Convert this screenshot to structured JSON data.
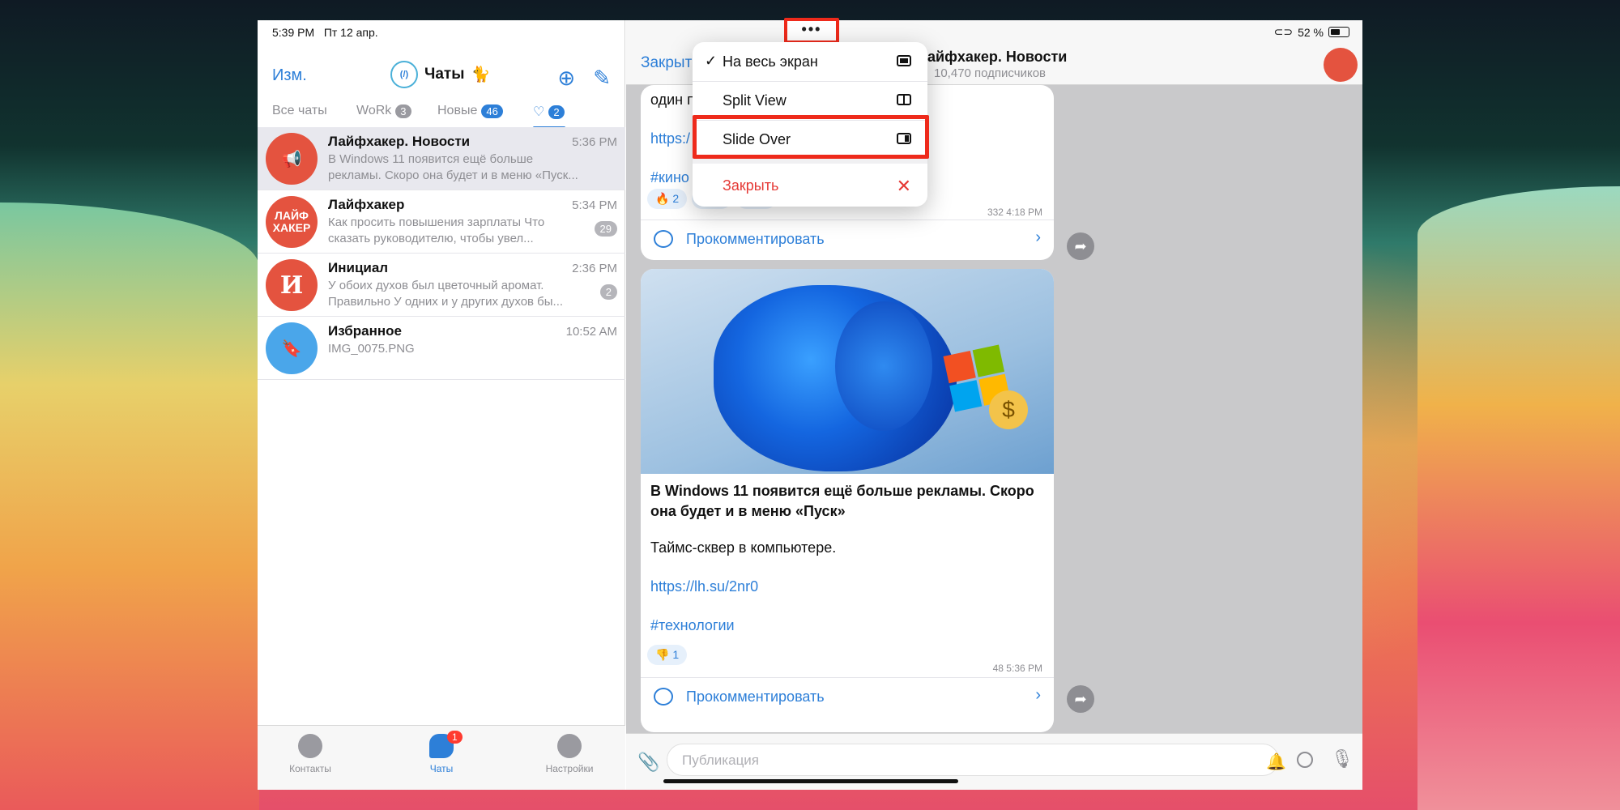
{
  "status": {
    "time": "5:39 PM",
    "date": "Пт 12 апр.",
    "battery": "52 %"
  },
  "left_header": {
    "edit": "Изм.",
    "title": "Чаты",
    "logo_text": "(/)"
  },
  "filters": [
    {
      "label": "Все чаты",
      "count": ""
    },
    {
      "label": "WoRk",
      "count": "3"
    },
    {
      "label": "Новые",
      "count": "46"
    },
    {
      "label": "♡",
      "count": "2"
    }
  ],
  "chats": [
    {
      "name": "Лайфхакер. Новости",
      "time": "5:36 PM",
      "preview": "В Windows 11 появится ещё больше рекламы. Скоро она будет и в меню «Пуск...",
      "count": "",
      "avatar_color": "#e4533f",
      "avatar_text": "📢"
    },
    {
      "name": "Лайфхакер",
      "time": "5:34 PM",
      "preview": "Как просить повышения зарплаты Что сказать руководителю, чтобы увел...",
      "count": "29",
      "avatar_color": "#e4533f",
      "avatar_text": "ЛАЙФ ХАКЕР"
    },
    {
      "name": "Инициал",
      "time": "2:36 PM",
      "preview": "У обоих духов был цветочный аромат. Правильно У одних и у других духов бы...",
      "count": "2",
      "avatar_color": "#e4533f",
      "avatar_text": "И"
    },
    {
      "name": "Избранное",
      "time": "10:52 AM",
      "preview": "IMG_0075.PNG",
      "count": "",
      "avatar_color": "#4aa6ea",
      "avatar_text": "🔖"
    }
  ],
  "tabbar": {
    "contacts": "Контакты",
    "chats": "Чаты",
    "chats_badge": "1",
    "settings": "Настройки"
  },
  "channel": {
    "close": "Закрыть",
    "name": "айфхакер. Новости",
    "subscribers": "10,470 подписчиков"
  },
  "post1": {
    "fragment1": "один п",
    "fragment2": "https:/",
    "fragment3": "#кино",
    "reactions": [
      "🔥 2",
      "🎯 2",
      "🦄 1"
    ],
    "meta": "332 4:18 PM"
  },
  "post2": {
    "title": "В Windows 11 появится ещё больше рекламы. Скоро она будет и в меню «Пуск»",
    "text": "Таймс-сквер в компьютере.",
    "link": "https://lh.su/2nr0",
    "tag": "#технологии",
    "reaction": "👎 1",
    "meta": "48 5:36 PM"
  },
  "comment_label": "Прокомментировать",
  "input_placeholder": "Публикация",
  "menu": {
    "dots": "•••",
    "items": [
      {
        "label": "На весь экран",
        "checked": true
      },
      {
        "label": "Split View",
        "checked": false
      },
      {
        "label": "Slide Over",
        "checked": false
      }
    ],
    "close": "Закрыть"
  }
}
